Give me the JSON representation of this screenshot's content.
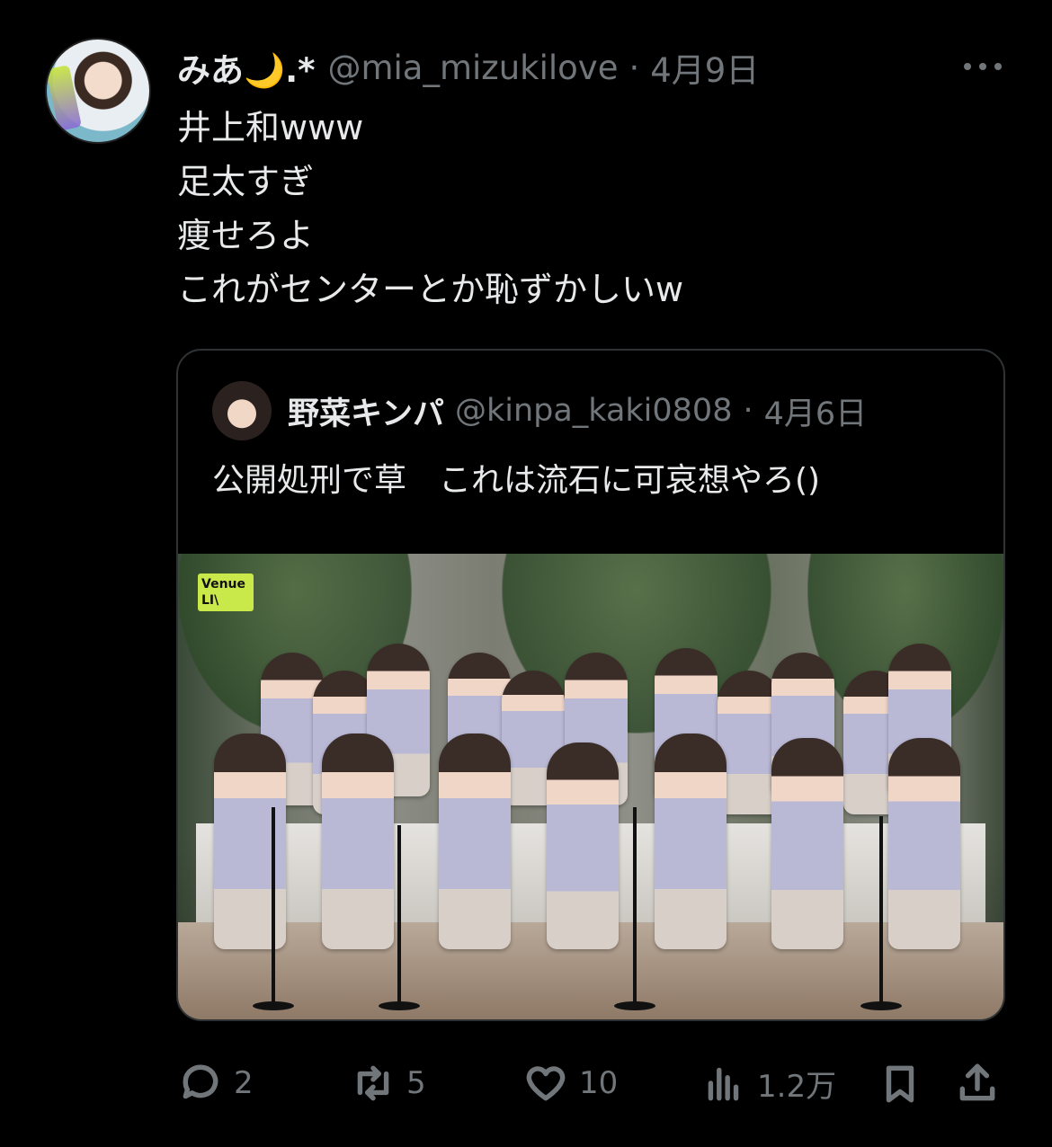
{
  "tweet": {
    "display_name": "みあ🌙.*",
    "handle": "@mia_mizukilove",
    "separator": "·",
    "date": "4月9日",
    "lines": [
      "井上和www",
      "足太すぎ",
      "痩せろよ",
      "これがセンターとか恥ずかしいw"
    ]
  },
  "quoted": {
    "display_name": "野菜キンパ",
    "handle": "@kinpa_kaki0808",
    "separator": "·",
    "date": "4月6日",
    "text": "公開処刑で草　これは流石に可哀想やろ()",
    "media_badge_line1": "Venue",
    "media_badge_line2": "LI\\"
  },
  "actions": {
    "reply_count": "2",
    "retweet_count": "5",
    "like_count": "10",
    "views_count": "1.2万"
  },
  "icons": [
    "more-icon",
    "reply-icon",
    "retweet-icon",
    "like-icon",
    "views-icon",
    "bookmark-icon",
    "share-icon"
  ]
}
